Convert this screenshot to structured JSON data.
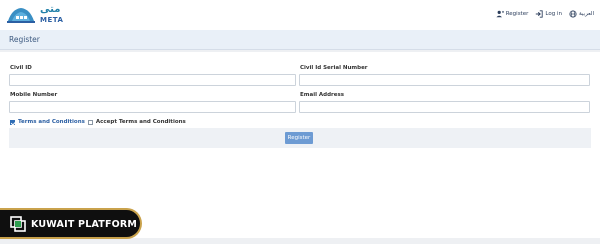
{
  "header": {
    "logo_arabic": "متى",
    "logo_latin": "META",
    "nav": {
      "register": "Register",
      "login": "Log in",
      "language": "العربية"
    }
  },
  "page": {
    "title": "Register"
  },
  "form": {
    "civil_id_label": "Civil ID",
    "civil_id_value": "",
    "civil_serial_label": "Civil Id Serial Number",
    "civil_serial_value": "",
    "mobile_label": "Mobile Number",
    "mobile_value": "",
    "email_label": "Email Address",
    "email_value": "",
    "terms_link": "Terms and Conditions",
    "accept_terms": "Accept Terms and Conditions",
    "submit_label": "Register"
  },
  "badge": {
    "text": "KUWAIT PLATFORM"
  },
  "colors": {
    "accent": "#2b5fa3",
    "button": "#6d9bd3",
    "badge_border": "#c9a24c"
  }
}
